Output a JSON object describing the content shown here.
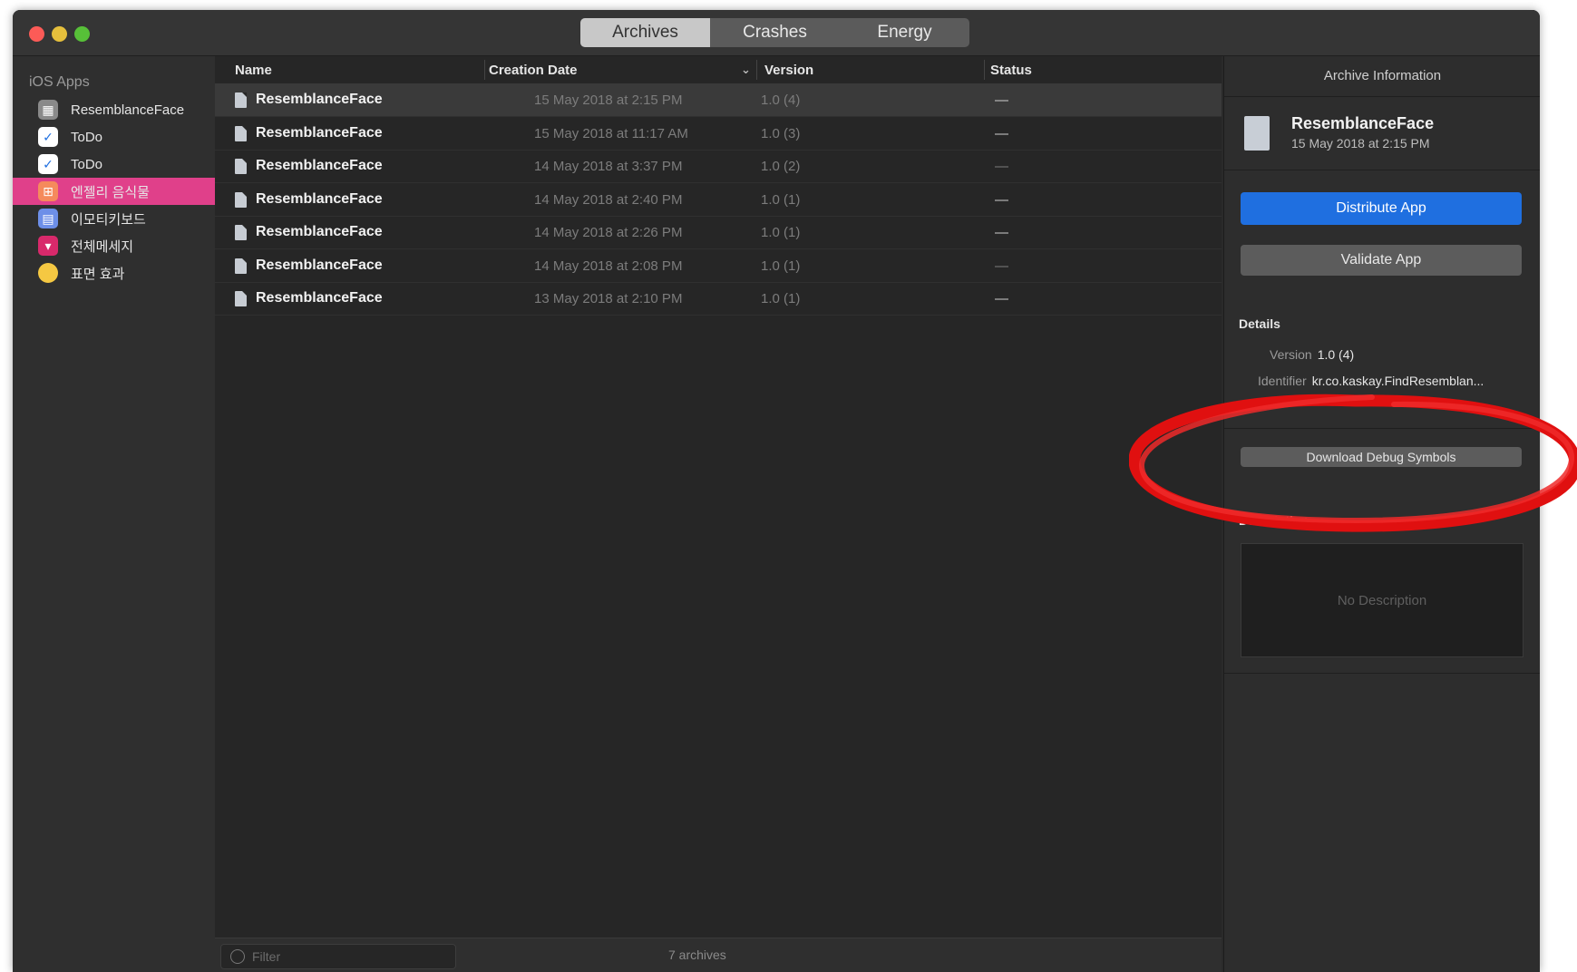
{
  "window": {
    "tabs": [
      {
        "label": "Archives",
        "active": true
      },
      {
        "label": "Crashes",
        "active": false
      },
      {
        "label": "Energy",
        "active": false
      }
    ]
  },
  "sidebar": {
    "section_title": "iOS Apps",
    "items": [
      {
        "label": "ResemblanceFace",
        "icon": "grid-app-icon",
        "selected": false
      },
      {
        "label": "ToDo",
        "icon": "checkmark-app-icon",
        "selected": false
      },
      {
        "label": "ToDo",
        "icon": "checkmark-app-icon",
        "selected": false
      },
      {
        "label": "엔젤리 음식물",
        "icon": "pink-app-icon",
        "selected": true
      },
      {
        "label": "이모티키보드",
        "icon": "keyboard-app-icon",
        "selected": false
      },
      {
        "label": "전체메세지",
        "icon": "message-app-icon",
        "selected": false
      },
      {
        "label": "표면 효과",
        "icon": "yellow-app-icon",
        "selected": false
      }
    ]
  },
  "table": {
    "columns": {
      "name": "Name",
      "date": "Creation Date",
      "version": "Version",
      "status": "Status"
    },
    "rows": [
      {
        "name": "ResemblanceFace",
        "date": "15 May 2018 at 2:15 PM",
        "version": "1.0 (4)",
        "status": "—"
      },
      {
        "name": "ResemblanceFace",
        "date": "15 May 2018 at 11:17 AM",
        "version": "1.0 (3)",
        "status": "—"
      },
      {
        "name": "ResemblanceFace",
        "date": "14 May 2018 at 3:37 PM",
        "version": "1.0 (2)",
        "status": "—"
      },
      {
        "name": "ResemblanceFace",
        "date": "14 May 2018 at 2:40 PM",
        "version": "1.0 (1)",
        "status": "—"
      },
      {
        "name": "ResemblanceFace",
        "date": "14 May 2018 at 2:26 PM",
        "version": "1.0 (1)",
        "status": "—"
      },
      {
        "name": "ResemblanceFace",
        "date": "14 May 2018 at 2:08 PM",
        "version": "1.0 (1)",
        "status": "—"
      },
      {
        "name": "ResemblanceFace",
        "date": "13 May 2018 at 2:10 PM",
        "version": "1.0 (1)",
        "status": "—"
      }
    ],
    "filter_placeholder": "Filter",
    "count_label": "7 archives"
  },
  "inspector": {
    "title": "Archive Information",
    "archive_name": "ResemblanceFace",
    "archive_date": "15 May 2018 at 2:15 PM",
    "distribute_label": "Distribute App",
    "validate_label": "Validate App",
    "details_title": "Details",
    "version_key": "Version",
    "version_value": "1.0 (4)",
    "identifier_key": "Identifier",
    "identifier_value": "kr.co.kaskay.FindResemblan...",
    "debug_symbols_label": "Download Debug Symbols",
    "description_title": "Description",
    "description_placeholder": "No Description"
  },
  "colors": {
    "accent": "#1f6fe0",
    "sidebar_selected": "#e0408a",
    "annotation": "#e01010"
  }
}
